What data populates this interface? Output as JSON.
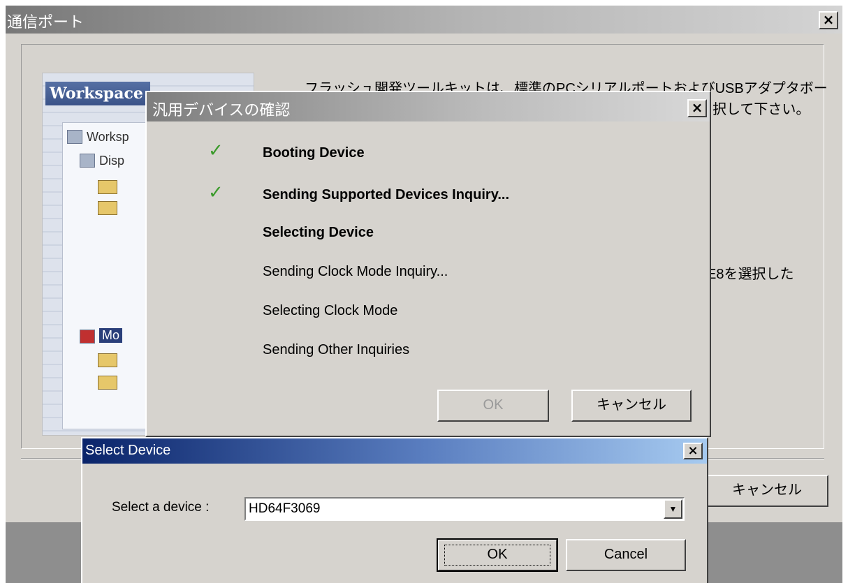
{
  "main": {
    "title": "通信ポート",
    "close_glyph": "×",
    "illustration": {
      "workspace_label": "Workspace",
      "tree_items": [
        "Worksp",
        "Disp",
        "Mo"
      ]
    },
    "description_line1": "フラッシュ開発ツールキットは、標準のPCシリアルポートおよびUSBアダプタボー",
    "description_line2": "択して下さい。",
    "description_line3": "E8を選択した",
    "cancel_label": "キャンセル"
  },
  "progress": {
    "title": "汎用デバイスの確認",
    "close_glyph": "×",
    "check_glyph": "✓",
    "steps": [
      {
        "label": "Booting Device",
        "done": true,
        "bold": true
      },
      {
        "label": "Sending Supported Devices Inquiry...",
        "done": true,
        "bold": true
      },
      {
        "label": "Selecting Device",
        "done": false,
        "bold": true
      },
      {
        "label": "Sending Clock Mode Inquiry...",
        "done": false,
        "bold": false
      },
      {
        "label": "Selecting Clock Mode",
        "done": false,
        "bold": false
      },
      {
        "label": "Sending Other Inquiries",
        "done": false,
        "bold": false
      }
    ],
    "ok_label": "OK",
    "cancel_label": "キャンセル"
  },
  "select_device": {
    "title": "Select Device",
    "close_glyph": "×",
    "label": "Select a device :",
    "selected_device": "HD64F3069",
    "dropdown_glyph": "▼",
    "ok_label": "OK",
    "cancel_label": "Cancel"
  },
  "colors": {
    "window_face": "#d6d3ce",
    "active_title_start": "#0a246a",
    "active_title_end": "#a6caf0",
    "check_green": "#3a9a2a"
  }
}
